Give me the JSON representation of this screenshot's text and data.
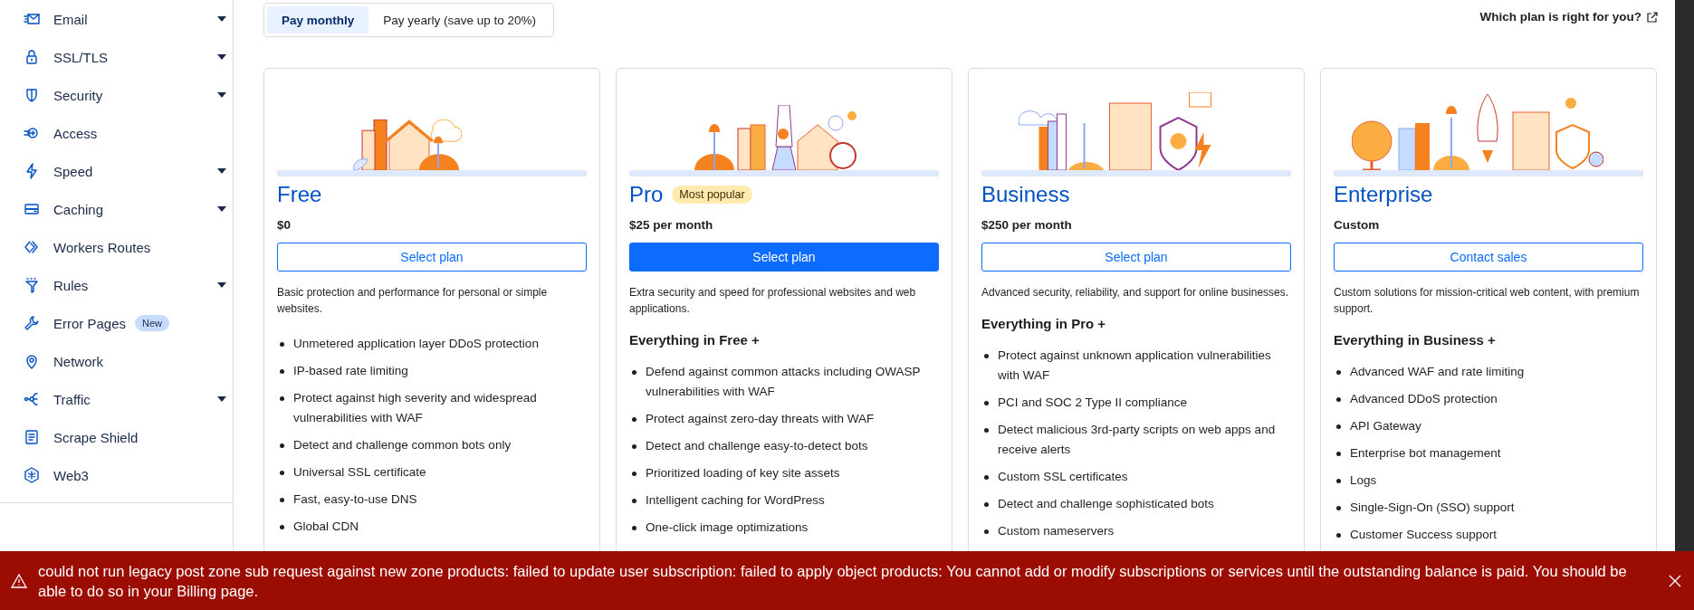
{
  "sidebar": {
    "items": [
      {
        "label": "Email",
        "has_menu": true
      },
      {
        "label": "SSL/TLS",
        "has_menu": true
      },
      {
        "label": "Security",
        "has_menu": true
      },
      {
        "label": "Access",
        "has_menu": false
      },
      {
        "label": "Speed",
        "has_menu": true
      },
      {
        "label": "Caching",
        "has_menu": true
      },
      {
        "label": "Workers Routes",
        "has_menu": false
      },
      {
        "label": "Rules",
        "has_menu": true
      },
      {
        "label": "Error Pages",
        "has_menu": false,
        "badge": "New"
      },
      {
        "label": "Network",
        "has_menu": false
      },
      {
        "label": "Traffic",
        "has_menu": true
      },
      {
        "label": "Scrape Shield",
        "has_menu": false
      },
      {
        "label": "Web3",
        "has_menu": false
      }
    ]
  },
  "billing_toggle": [
    {
      "label": "Pay monthly",
      "selected": true
    },
    {
      "label": "Pay yearly (save up to 20%)",
      "selected": false
    }
  ],
  "help_link": "Which plan is right for you?",
  "plans": [
    {
      "name": "Free",
      "price": "$0",
      "button": {
        "label": "Select plan",
        "primary": false
      },
      "description": "Basic protection and performance for personal or simple websites.",
      "features": [
        "Unmetered application layer DDoS protection",
        "IP-based rate limiting",
        "Protect against high severity and widespread vulnerabilities with WAF",
        "Detect and challenge common bots only",
        "Universal SSL certificate",
        "Fast, easy-to-use DNS",
        "Global CDN"
      ]
    },
    {
      "name": "Pro",
      "badge": "Most popular",
      "price": "$25 per month",
      "button": {
        "label": "Select plan",
        "primary": true
      },
      "description": "Extra security and speed for professional websites and web applications.",
      "features_heading": "Everything in Free +",
      "features": [
        "Defend against common attacks including OWASP vulnerabilities with WAF",
        "Protect against zero-day threats with WAF",
        "Detect and challenge easy-to-detect bots",
        "Prioritized loading of key site assets",
        "Intelligent caching for WordPress",
        "One-click image optimizations"
      ]
    },
    {
      "name": "Business",
      "price": "$250 per month",
      "button": {
        "label": "Select plan",
        "primary": false
      },
      "description": "Advanced security, reliability, and support for online businesses.",
      "features_heading": "Everything in Pro +",
      "features": [
        "Protect against unknown application vulnerabilities with WAF",
        "PCI and SOC 2 Type II compliance",
        "Detect malicious 3rd-party scripts on web apps and receive alerts",
        "Custom SSL certificates",
        "Detect and challenge sophisticated bots",
        "Custom nameservers"
      ]
    },
    {
      "name": "Enterprise",
      "price": "Custom",
      "button": {
        "label": "Contact sales",
        "primary": false
      },
      "description": "Custom solutions for mission-critical web content, with premium support.",
      "features_heading": "Everything in Business +",
      "features": [
        "Advanced WAF and rate limiting",
        "Advanced DDoS protection",
        "API Gateway",
        "Enterprise bot management",
        "Logs",
        "Single-Sign-On (SSO) support",
        "Customer Success support"
      ]
    }
  ],
  "error_banner": {
    "message": "could not run legacy post zone sub request against new zone products: failed to update user subscription: failed to apply object products: You cannot add or modify subscriptions or services until the outstanding balance is paid. You should be able to do so in your Billing page."
  }
}
